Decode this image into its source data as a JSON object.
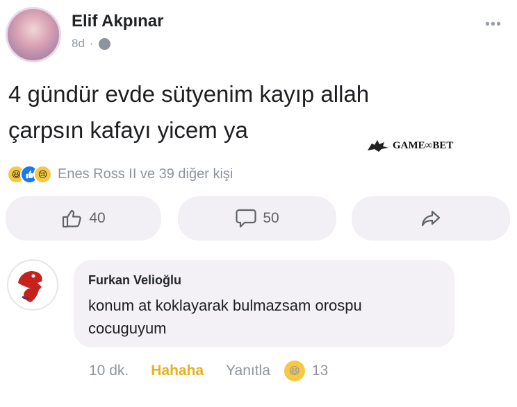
{
  "post": {
    "author": "Elif Akpınar",
    "time": "8d",
    "separator": "·",
    "more": "•••",
    "text_line1": "4 gündür evde sütyenim kayıp allah",
    "text_line2": "çarpsın kafayı yicem ya",
    "watermark": "GAME∞BET",
    "reactions_text": "Enes Ross II ve 39 diğer kişi",
    "reaction_icons": [
      "haha-icon",
      "like-icon",
      "sad-icon"
    ]
  },
  "actions": {
    "like_count": "40",
    "comment_count": "50"
  },
  "comment": {
    "author": "Furkan Velioğlu",
    "text": "konum at koklayarak bulmazsam orospu cocuguyum",
    "time": "10 dk.",
    "haha_label": "Hahaha",
    "reply_label": "Yanıtla",
    "reaction_count": "13"
  },
  "colors": {
    "accent_blue": "#1877f2",
    "haha_yellow": "#e5b21f",
    "action_bg": "#f2f0f5"
  }
}
